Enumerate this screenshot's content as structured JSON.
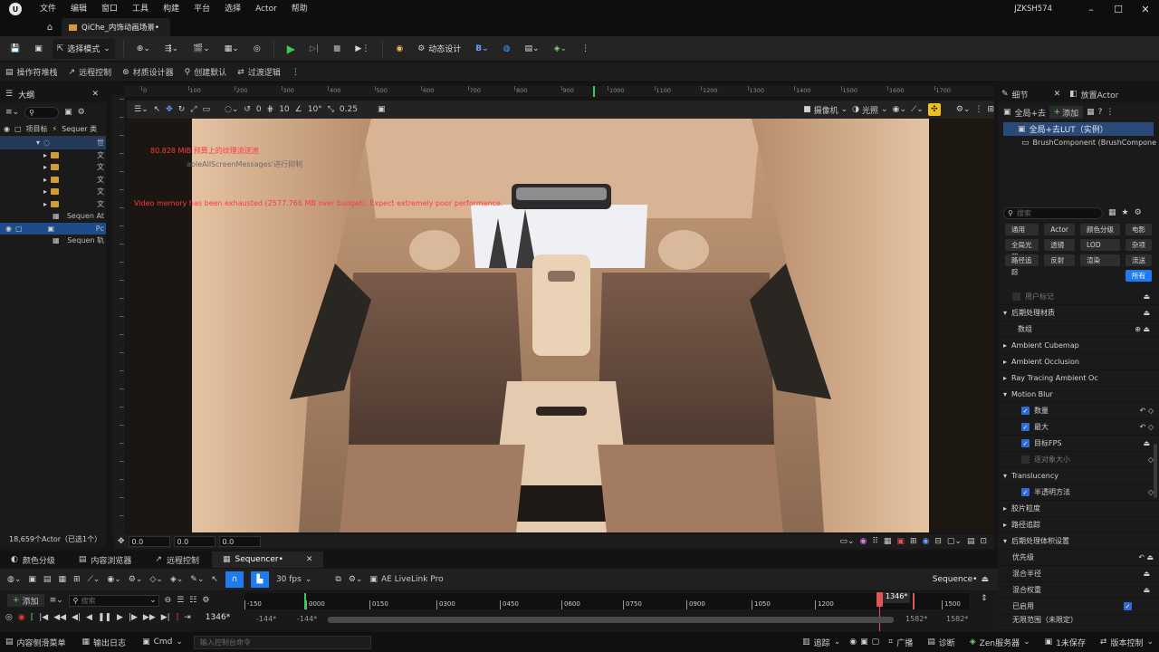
{
  "app": {
    "menu": [
      "文件",
      "编辑",
      "窗口",
      "工具",
      "构建",
      "平台",
      "选择",
      "Actor",
      "帮助"
    ],
    "doc_tab": "QiChe_内饰动画场景•",
    "user": "JZKSH574"
  },
  "toolbar": {
    "select_mode": "选择模式",
    "dynamic_design": "动态设计"
  },
  "toolbar2": [
    "操作符堆栈",
    "远程控制",
    "材质设计器",
    "创建默认",
    "过渡逻辑"
  ],
  "outliner": {
    "title": "大纲",
    "col_label": "项目标",
    "col_type": "Sequer 类",
    "rows": [
      {
        "label": "世",
        "kind": "world"
      },
      {
        "label": "文",
        "kind": "folder"
      },
      {
        "label": "文",
        "kind": "folder"
      },
      {
        "label": "文",
        "kind": "folder"
      },
      {
        "label": "文",
        "kind": "folder"
      },
      {
        "label": "文",
        "kind": "folder"
      },
      {
        "label": "Sequen At",
        "kind": "item"
      },
      {
        "label": "Pc",
        "kind": "item-selected"
      },
      {
        "label": "Sequen 轨",
        "kind": "item"
      }
    ],
    "footer": "18,659个Actor（已选1个）"
  },
  "ruler": {
    "marks": [
      "0",
      "100",
      "200",
      "300",
      "400",
      "500",
      "600",
      "700",
      "800",
      "900",
      "1000",
      "1100",
      "1200",
      "1300",
      "1400",
      "1500",
      "1600",
      "1700"
    ]
  },
  "viewport": {
    "snap_angle": "10°",
    "snap_grid": "10",
    "snap_scale": "0.25",
    "snap_rot": "0",
    "camera_label": "摄像机",
    "lit_label": "光照",
    "msg_line1": "80.828 MiB 预算上的纹理流送池",
    "msg_line2": "ableAllScreenMessages'进行抑制",
    "msg_line3": "Video memory has been exhausted (2577.766 MB over budget). Expect extremely poor performance.",
    "coord_x": "0.0",
    "coord_y": "0.0",
    "coord_z": "0.0"
  },
  "details": {
    "tab_details": "细节",
    "tab_place": "放置Actor",
    "actor_name": "全局+去",
    "add_label": "添加",
    "selected_item": "全局+去LUT（实例）",
    "component": "BrushComponent (BrushCompone",
    "search_placeholder": "搜索",
    "filters": [
      "通用",
      "Actor",
      "颜色分级",
      "电影",
      "全局光照",
      "透镜",
      "LOD",
      "杂项",
      "路径追踪",
      "反射",
      "渲染",
      "流送",
      "所有"
    ],
    "rows": [
      {
        "label": "用户标记",
        "type": "prop-dim"
      },
      {
        "label": "后期处理材质",
        "type": "cat-open"
      },
      {
        "label": "数组",
        "type": "prop"
      },
      {
        "label": "Ambient Cubemap",
        "type": "cat"
      },
      {
        "label": "Ambient Occlusion",
        "type": "cat"
      },
      {
        "label": "Ray Tracing Ambient Oc",
        "type": "cat"
      },
      {
        "label": "Motion Blur",
        "type": "cat-open"
      },
      {
        "label": "数量",
        "type": "check"
      },
      {
        "label": "最大",
        "type": "check"
      },
      {
        "label": "目标FPS",
        "type": "check"
      },
      {
        "label": "逐对象大小",
        "type": "check-off"
      },
      {
        "label": "Translucency",
        "type": "cat-open"
      },
      {
        "label": "半透明方法",
        "type": "check"
      },
      {
        "label": "胶片粒度",
        "type": "cat"
      },
      {
        "label": "路径追踪",
        "type": "cat"
      },
      {
        "label": "后期处理体积设置",
        "type": "cat-open"
      },
      {
        "label": "优先级",
        "type": "prop"
      },
      {
        "label": "混合半径",
        "type": "prop"
      },
      {
        "label": "混合权重",
        "type": "prop"
      },
      {
        "label": "已启用",
        "type": "prop"
      },
      {
        "label": "无限范围（未限定）",
        "type": "prop"
      }
    ]
  },
  "sequencer": {
    "tabs": [
      "颜色分级",
      "内容浏览器",
      "远程控制",
      "Sequencer•"
    ],
    "add_label": "添加",
    "search_placeholder": "搜索",
    "fps": "30 fps",
    "livelink": "AE LiveLink Pro",
    "seq_name": "Sequence•",
    "timeline_marks": [
      "-150",
      "0000",
      "0150",
      "0300",
      "0450",
      "0600",
      "0750",
      "0900",
      "1050",
      "1200",
      "1500"
    ],
    "playhead": "1346*",
    "current_frame": "1346*",
    "range_start_a": "-144*",
    "range_start_b": "-144*",
    "range_end_a": "1582*",
    "range_end_b": "1582*"
  },
  "statusbar": {
    "content_drawer": "内容侧滑菜单",
    "output_log": "输出日志",
    "cmd": "Cmd",
    "cmd_placeholder": "输入控制台命令",
    "trace": "追踪",
    "broadcast": "广播",
    "diagnose": "诊断",
    "zen": "Zen服务器",
    "unsaved": "1未保存",
    "version": "版本控制"
  }
}
